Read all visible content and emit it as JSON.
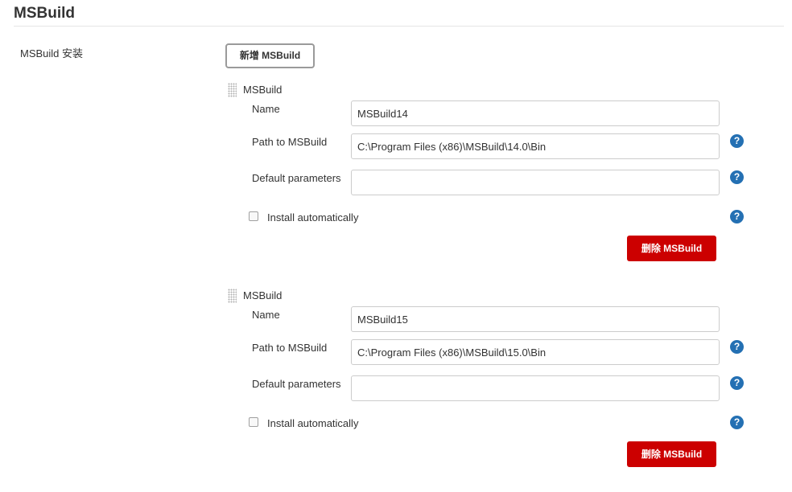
{
  "section": {
    "title": "MSBuild",
    "row_label": "MSBuild 安装",
    "add_button_label": "新增 MSBuild"
  },
  "installations": [
    {
      "title": "MSBuild",
      "name_label": "Name",
      "name_value": "MSBuild14",
      "path_label": "Path to MSBuild",
      "path_value": "C:\\Program Files (x86)\\MSBuild\\14.0\\Bin",
      "params_label": "Default parameters",
      "params_value": "",
      "install_label": "Install automatically",
      "install_checked": false,
      "delete_label": "删除 MSBuild"
    },
    {
      "title": "MSBuild",
      "name_label": "Name",
      "name_value": "MSBuild15",
      "path_label": "Path to MSBuild",
      "path_value": "C:\\Program Files (x86)\\MSBuild\\15.0\\Bin",
      "params_label": "Default parameters",
      "params_value": "",
      "install_label": "Install automatically",
      "install_checked": false,
      "delete_label": "删除 MSBuild"
    }
  ],
  "help_icon_glyph": "?",
  "colors": {
    "delete_button": "#cc0000",
    "help_icon": "#2470b3"
  },
  "icons": [
    "drag-handle-icon",
    "help-icon"
  ]
}
